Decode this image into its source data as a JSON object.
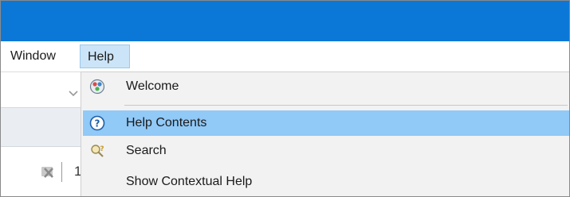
{
  "menubar": {
    "items": [
      {
        "label": "Window"
      },
      {
        "label": "Help"
      }
    ]
  },
  "help_menu": {
    "items": [
      {
        "label": "Welcome",
        "icon": "welcome-icon"
      },
      {
        "label": "Help Contents",
        "icon": "help-contents-icon",
        "highlighted": true
      },
      {
        "label": "Search",
        "icon": "search-help-icon"
      },
      {
        "label": "Show Contextual Help",
        "icon": null
      }
    ]
  },
  "colors": {
    "titlebar": "#0b78d7",
    "menu_open_bg": "#cce4f7",
    "highlight": "#91c9f7",
    "dropdown_bg": "#f2f2f2"
  }
}
